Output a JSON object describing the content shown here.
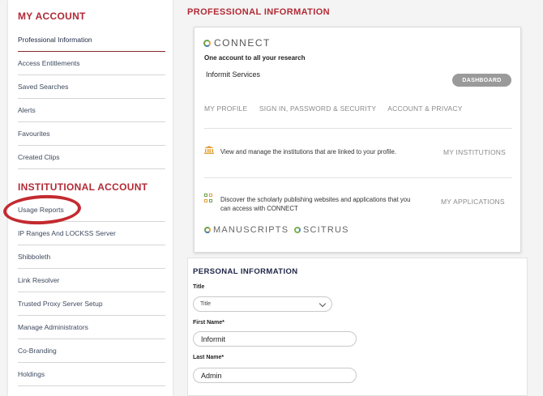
{
  "sidebar": {
    "my_account_title": "MY ACCOUNT",
    "my_account_items": [
      "Professional Information",
      "Access Entitlements",
      "Saved Searches",
      "Alerts",
      "Favourites",
      "Created Clips"
    ],
    "institutional_title": "INSTITUTIONAL ACCOUNT",
    "institutional_items": [
      "Usage Reports",
      "IP Ranges And LOCKSS Server",
      "Shibboleth",
      "Link Resolver",
      "Trusted Proxy Server Setup",
      "Manage Administrators",
      "Co-Branding",
      "Holdings"
    ]
  },
  "main": {
    "page_title": "PROFESSIONAL INFORMATION",
    "connect": {
      "logo_text": "CONNECT",
      "tagline": "One account to all your research",
      "service_name": "Informit Services",
      "dashboard_label": "DASHBOARD",
      "tabs": [
        "MY PROFILE",
        "SIGN IN, PASSWORD & SECURITY",
        "ACCOUNT & PRIVACY"
      ],
      "institutions_text": "View and manage the institutions that are linked to your profile.",
      "institutions_link": "MY INSTITUTIONS",
      "applications_text_1": "Discover the scholarly publishing websites and applications that you",
      "applications_text_2": "can access with CONNECT",
      "applications_link": "MY APPLICATIONS",
      "brands": [
        "MANUSCRIPTS",
        "SCITRUS"
      ]
    },
    "personal": {
      "section_title": "PERSONAL INFORMATION",
      "title_label": "Title",
      "title_select_value": "Title",
      "first_name_label": "First Name*",
      "first_name_value": "Informit",
      "last_name_label": "Last Name*",
      "last_name_value": "Admin"
    }
  },
  "colors": {
    "section_red": "#b22a35",
    "annotation_red": "#c32a2f",
    "navy": "#1d2546",
    "dashboard_grey": "#9a9a9a"
  }
}
